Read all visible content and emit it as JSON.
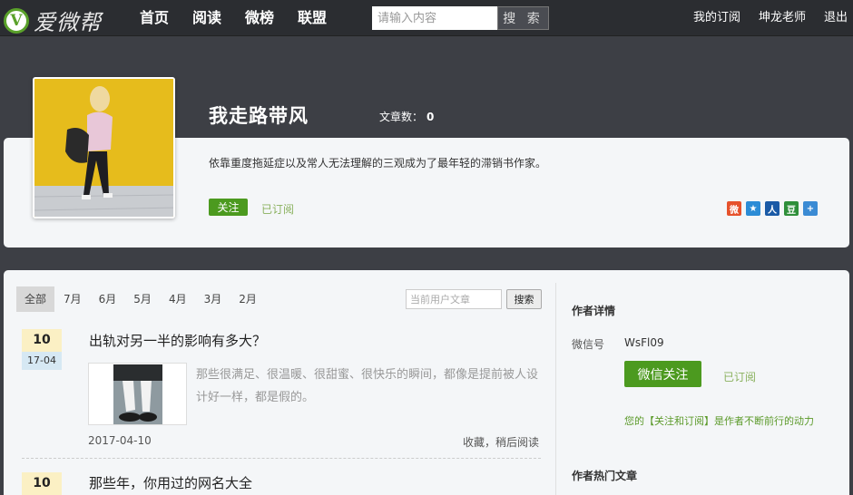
{
  "header": {
    "logo_letter": "V",
    "logo_text": "爱微帮",
    "nav": [
      "首页",
      "阅读",
      "微榜",
      "联盟"
    ],
    "search_placeholder": "请输入内容",
    "search_button": "搜 索",
    "right_links": [
      "我的订阅",
      "坤龙老师",
      "退出"
    ]
  },
  "profile": {
    "name": "我走路带风",
    "article_count_label": "文章数：",
    "article_count": "0",
    "bio": "依靠重度拖延症以及常人无法理解的三观成为了最年轻的滞销书作家。",
    "follow_label": "关注",
    "subscribed_label": "已订阅",
    "share_icons": [
      {
        "icon": "weibo-icon",
        "glyph": "微",
        "color": "#e6522c"
      },
      {
        "icon": "qzone-icon",
        "glyph": "★",
        "color": "#2c8cd6"
      },
      {
        "icon": "renren-icon",
        "glyph": "人",
        "color": "#1a5aa6"
      },
      {
        "icon": "douban-icon",
        "glyph": "豆",
        "color": "#2f8f3a"
      },
      {
        "icon": "more-share-icon",
        "glyph": "+",
        "color": "#3b8bd4"
      }
    ]
  },
  "filters": {
    "months": [
      "全部",
      "7月",
      "6月",
      "5月",
      "4月",
      "3月",
      "2月"
    ],
    "active_index": 0,
    "search_placeholder": "当前用户文章",
    "search_button": "搜索"
  },
  "articles": [
    {
      "day": "10",
      "month_day": "17-04",
      "title": "出轨对另一半的影响有多大？",
      "summary": "那些很满足、很温暖、很甜蜜、很快乐的瞬间，都像是提前被人设计好一样，都是假的。",
      "date": "2017-04-10",
      "actions": "收藏，稍后阅读"
    },
    {
      "day": "10",
      "title": "那些年，你用过的网名大全"
    }
  ],
  "author_detail": {
    "heading": "作者详情",
    "wechat_label": "微信号",
    "wechat_id": "WsFl09",
    "follow_button": "微信关注",
    "subscribed_label": "已订阅",
    "motivation": "您的【关注和订阅】是作者不断前行的动力",
    "hot_heading": "作者热门文章"
  }
}
